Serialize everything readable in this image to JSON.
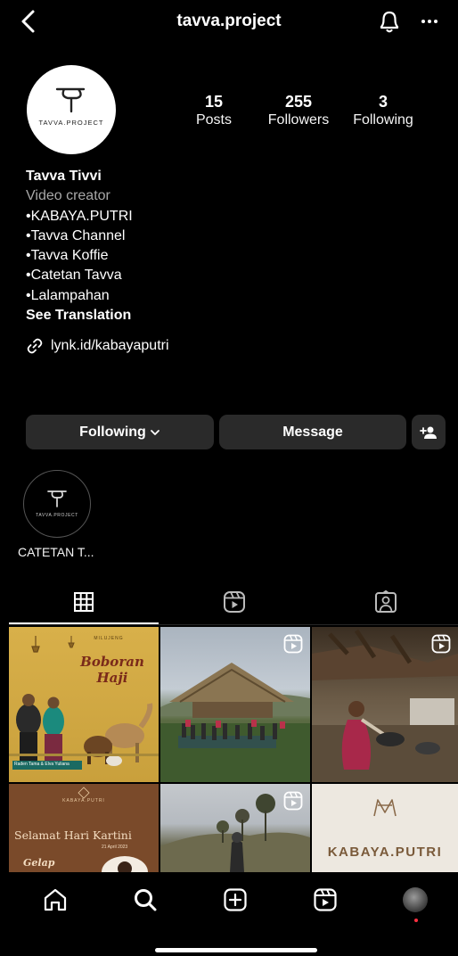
{
  "header": {
    "username": "tavva.project"
  },
  "profile": {
    "avatar_text": "TAVVA.PROJECT",
    "stats": [
      {
        "value": "15",
        "label": "Posts"
      },
      {
        "value": "255",
        "label": "Followers"
      },
      {
        "value": "3",
        "label": "Following"
      }
    ],
    "name": "Tavva Tivvi",
    "category": "Video creator",
    "bio_lines": [
      "•KABAYA.PUTRI",
      "•Tavva Channel",
      "•Tavva Koffie",
      "•Catetan Tavva",
      "•Lalampahan"
    ],
    "see_translation": "See Translation",
    "link": "lynk.id/kabayaputri"
  },
  "actions": {
    "following_label": "Following",
    "message_label": "Message"
  },
  "highlights": [
    {
      "label": "CATETAN T...",
      "logo_text": "TAVVA.PROJECT"
    }
  ],
  "grid": {
    "post1": {
      "title": "Boboran Haji",
      "top": "MILUJENG",
      "caption": "Raden Tama & Elva Yuliana"
    },
    "post4": {
      "brand": "KABAYA.PUTRI",
      "title": "Selamat Hari Kartini",
      "date": "21 April 2023",
      "sub": "Gelap"
    },
    "post6": {
      "brand": "KABAYA.PUTRI"
    }
  },
  "colors": {
    "background": "#000000",
    "button": "#2a2a2a",
    "muted": "#a8a8a8",
    "notification_dot": "#ff3040"
  }
}
